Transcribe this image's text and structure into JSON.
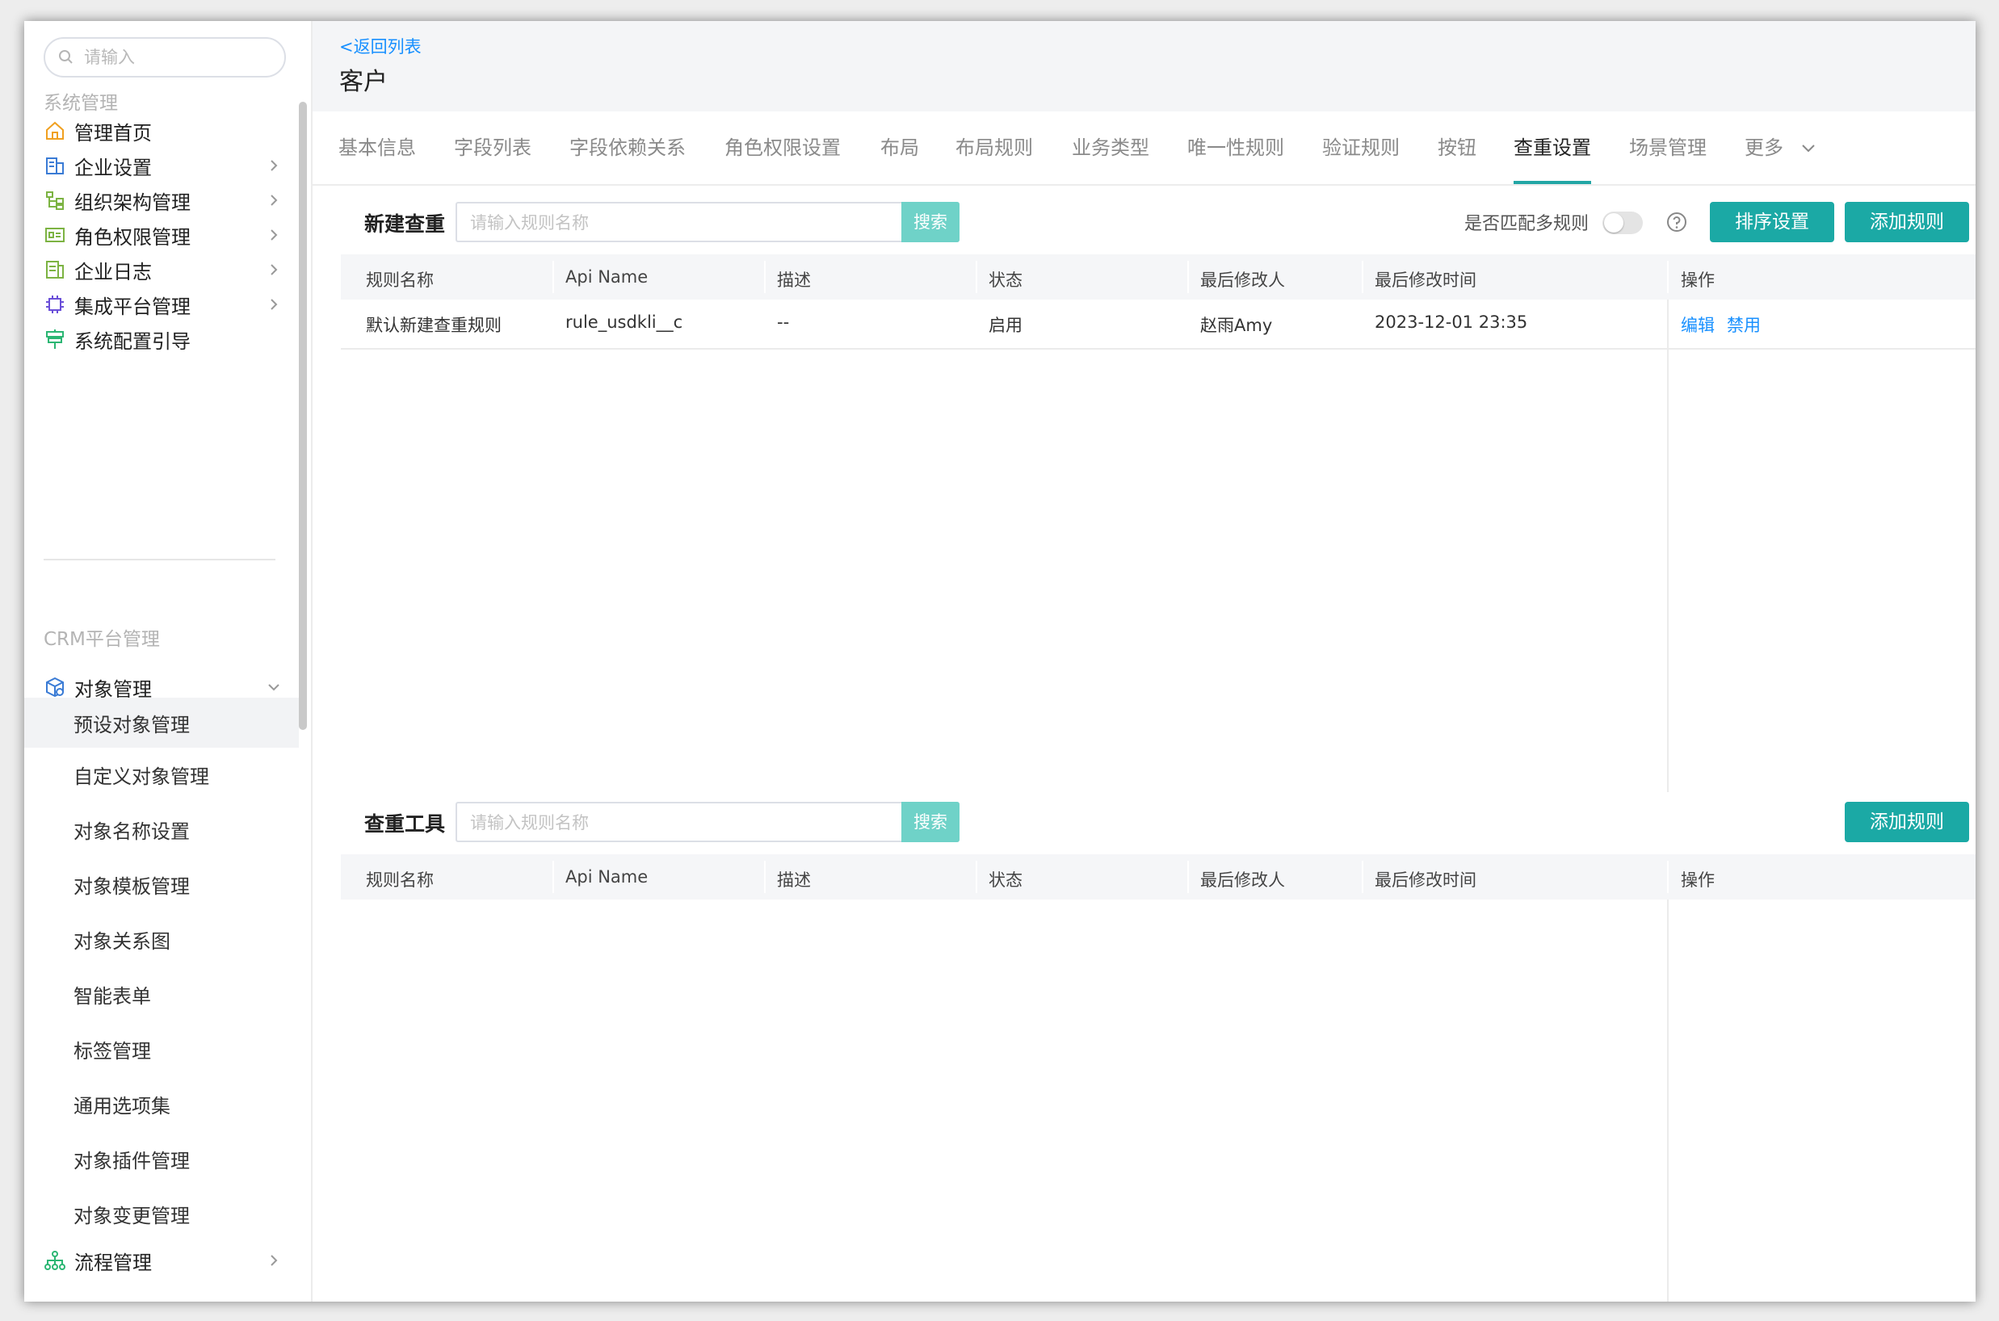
{
  "sidebar": {
    "search_placeholder": "请输入",
    "group1_title": "系统管理",
    "group2_title": "CRM平台管理",
    "items": [
      {
        "label": "管理首页"
      },
      {
        "label": "企业设置"
      },
      {
        "label": "组织架构管理"
      },
      {
        "label": "角色权限管理"
      },
      {
        "label": "企业日志"
      },
      {
        "label": "集成平台管理"
      },
      {
        "label": "系统配置引导"
      }
    ],
    "object_mgmt": {
      "label": "对象管理"
    },
    "sub_items": [
      {
        "label": "预设对象管理"
      },
      {
        "label": "自定义对象管理"
      },
      {
        "label": "对象名称设置"
      },
      {
        "label": "对象模板管理"
      },
      {
        "label": "对象关系图"
      },
      {
        "label": "智能表单"
      },
      {
        "label": "标签管理"
      },
      {
        "label": "通用选项集"
      },
      {
        "label": "对象插件管理"
      },
      {
        "label": "对象变更管理"
      }
    ],
    "process_mgmt": {
      "label": "流程管理"
    }
  },
  "header": {
    "back_link": "<返回列表",
    "title": "客户"
  },
  "tabs": [
    {
      "label": "基本信息"
    },
    {
      "label": "字段列表"
    },
    {
      "label": "字段依赖关系"
    },
    {
      "label": "角色权限设置"
    },
    {
      "label": "布局"
    },
    {
      "label": "布局规则"
    },
    {
      "label": "业务类型"
    },
    {
      "label": "唯一性规则"
    },
    {
      "label": "验证规则"
    },
    {
      "label": "按钮"
    },
    {
      "label": "查重设置"
    },
    {
      "label": "场景管理"
    },
    {
      "label": "更多"
    }
  ],
  "section1": {
    "label": "新建查重",
    "search_placeholder": "请输入规则名称",
    "search_button": "搜索",
    "toggle_label": "是否匹配多规则",
    "sort_button": "排序设置",
    "add_button": "添加规则"
  },
  "section2": {
    "label": "查重工具",
    "search_placeholder": "请输入规则名称",
    "search_button": "搜索",
    "add_button": "添加规则"
  },
  "table": {
    "columns": [
      "规则名称",
      "Api Name",
      "描述",
      "状态",
      "最后修改人",
      "最后修改时间",
      "操作"
    ]
  },
  "rows": [
    {
      "name": "默认新建查重规则",
      "api": "rule_usdkli__c",
      "desc": "--",
      "status": "启用",
      "modifier": "赵雨Amy",
      "time": "2023-12-01 23:35",
      "edit": "编辑",
      "disable": "禁用"
    }
  ],
  "colors": {
    "accent": "#1ba9a5",
    "link": "#1890ff",
    "search_btn": "#6fd2c8"
  }
}
